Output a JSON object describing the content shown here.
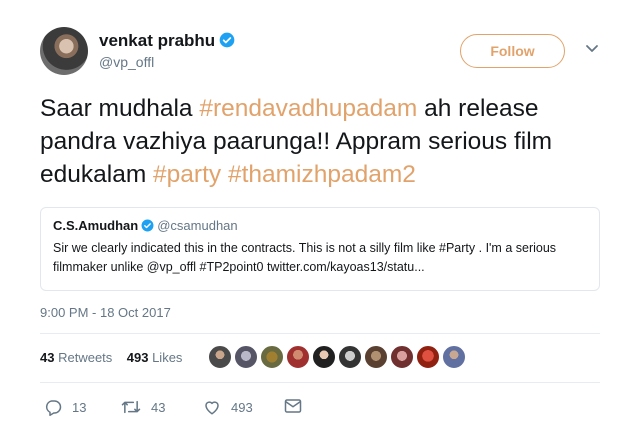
{
  "author": {
    "name": "venkat prabhu",
    "handle": "@vp_offl",
    "follow_label": "Follow"
  },
  "tweet": {
    "parts": [
      "Saar mudhala ",
      "#rendavadhupadam",
      " ah release pandra vazhiya paarunga!! Appram serious film edukalam ",
      "#party",
      " ",
      "#thamizhpadam2"
    ]
  },
  "quote": {
    "name": "C.S.Amudhan",
    "handle": "@csamudhan",
    "text": "Sir we clearly indicated this in the contracts. This is not a silly film like #Party . I'm a serious filmmaker unlike @vp_offl  #TP2point0 twitter.com/kayoas13/statu..."
  },
  "timestamp": "9:00 PM - 18 Oct 2017",
  "stats": {
    "retweets_count": "43",
    "retweets_label": "Retweets",
    "likes_count": "493",
    "likes_label": "Likes"
  },
  "actions": {
    "reply_count": "13",
    "retweet_count": "43",
    "like_count": "493"
  },
  "colors": {
    "accent": "#e1a36b",
    "verified": "#1da1f2",
    "secondary_text": "#657786",
    "border": "#e1e8ed"
  },
  "icons": [
    "verified-badge-icon",
    "chevron-down-icon",
    "reply-icon",
    "retweet-icon",
    "heart-icon",
    "mail-icon"
  ]
}
